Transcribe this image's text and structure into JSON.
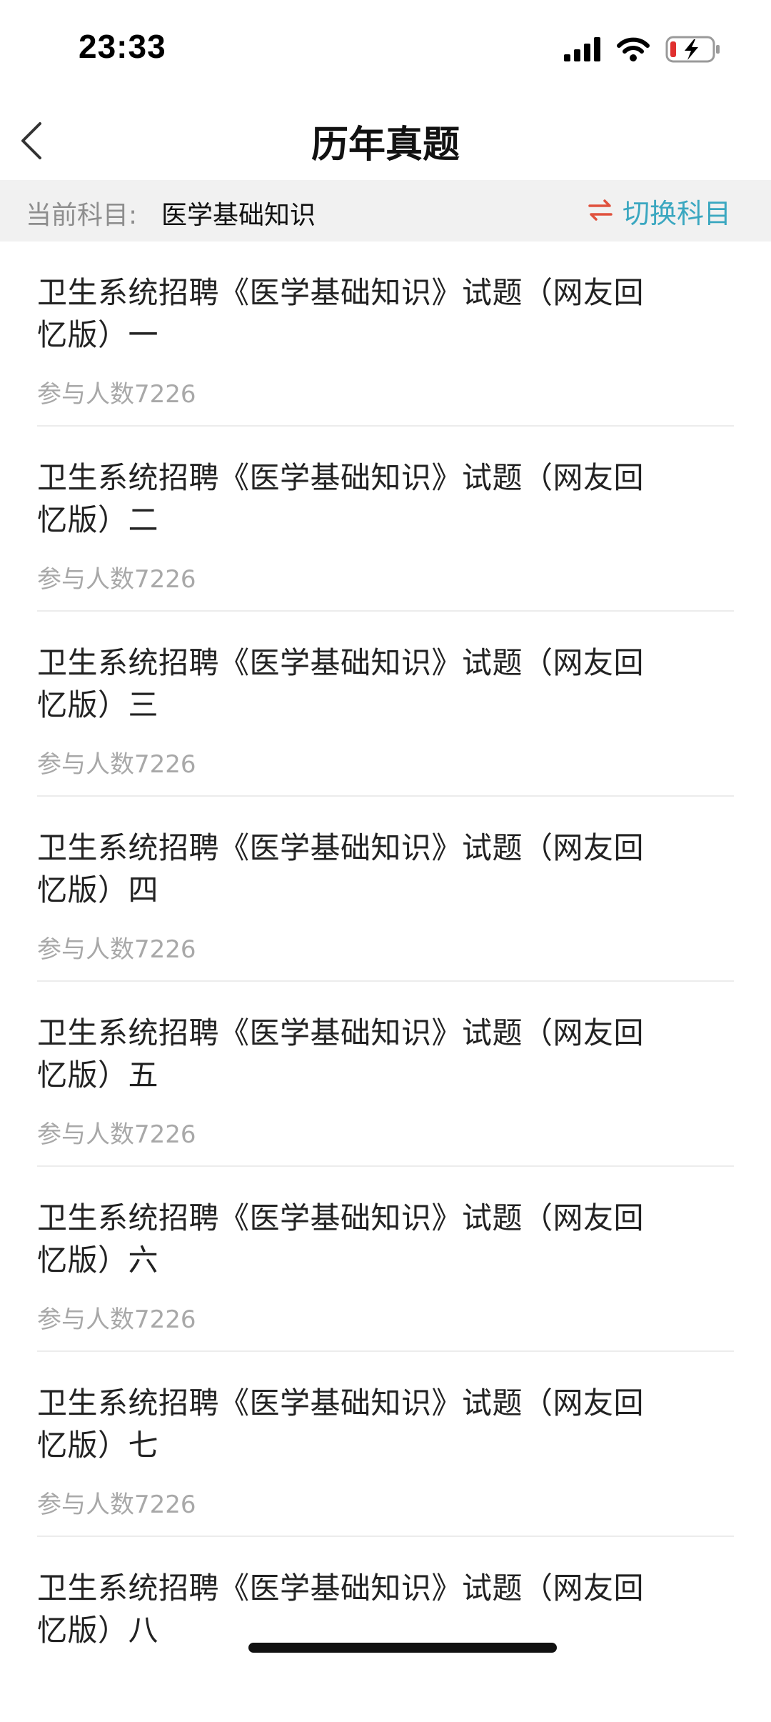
{
  "status_bar": {
    "time": "23:33"
  },
  "header": {
    "title": "历年真题",
    "back_icon": "chevron-left-icon"
  },
  "subject_bar": {
    "label": "当前科目:",
    "value": "医学基础知识",
    "switch_label": "切换科目",
    "switch_icon": "swap-arrows-icon",
    "switch_icon_color": "#e0513d",
    "switch_label_color": "#3aa7c0"
  },
  "exam_list": [
    {
      "title": "卫生系统招聘《医学基础知识》试题（网友回忆版）一",
      "participants": "参与人数7226"
    },
    {
      "title": "卫生系统招聘《医学基础知识》试题（网友回忆版）二",
      "participants": "参与人数7226"
    },
    {
      "title": "卫生系统招聘《医学基础知识》试题（网友回忆版）三",
      "participants": "参与人数7226"
    },
    {
      "title": "卫生系统招聘《医学基础知识》试题（网友回忆版）四",
      "participants": "参与人数7226"
    },
    {
      "title": "卫生系统招聘《医学基础知识》试题（网友回忆版）五",
      "participants": "参与人数7226"
    },
    {
      "title": "卫生系统招聘《医学基础知识》试题（网友回忆版）六",
      "participants": "参与人数7226"
    },
    {
      "title": "卫生系统招聘《医学基础知识》试题（网友回忆版）七",
      "participants": "参与人数7226"
    },
    {
      "title": "卫生系统招聘《医学基础知识》试题（网友回忆版）八",
      "participants": ""
    }
  ]
}
